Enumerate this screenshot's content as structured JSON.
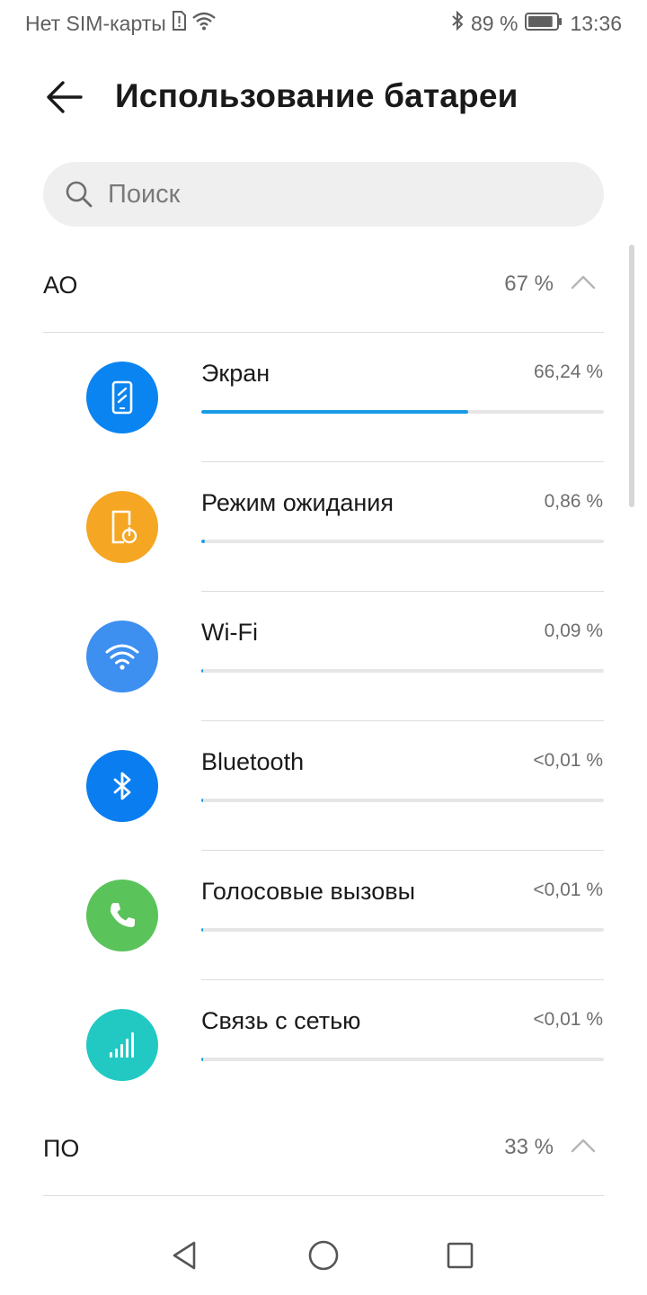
{
  "status_bar": {
    "carrier": "Нет SIM-карты",
    "battery_percent": "89 %",
    "time": "13:36",
    "icons": [
      "sim-alert-icon",
      "wifi-icon",
      "bluetooth-icon",
      "battery-icon"
    ],
    "battery_level": 0.89
  },
  "header": {
    "title": "Использование батареи",
    "back_icon": "back-arrow-icon"
  },
  "search": {
    "placeholder": "Поиск",
    "value": ""
  },
  "sections": [
    {
      "title": "АО",
      "percent": "67 %",
      "expanded": true,
      "items": [
        {
          "name": "Экран",
          "percent": "66,24 %",
          "usage": 0.6624,
          "icon": "phone-screen-icon",
          "color": "#0a84f0"
        },
        {
          "name": "Режим ожидания",
          "percent": "0,86 %",
          "usage": 0.0086,
          "icon": "phone-standby-icon",
          "color": "#f5a623"
        },
        {
          "name": "Wi-Fi",
          "percent": "0,09 %",
          "usage": 0.0009,
          "icon": "wifi-icon",
          "color": "#3d8ff0"
        },
        {
          "name": "Bluetooth",
          "percent": "<0,01 %",
          "usage": 0.0001,
          "icon": "bluetooth-icon",
          "color": "#0a7ef0"
        },
        {
          "name": "Голосовые вызовы",
          "percent": "<0,01 %",
          "usage": 0.0001,
          "icon": "phone-call-icon",
          "color": "#5ac35a"
        },
        {
          "name": "Связь с сетью",
          "percent": "<0,01 %",
          "usage": 0.0001,
          "icon": "signal-bars-icon",
          "color": "#22c9c2"
        }
      ]
    },
    {
      "title": "ПО",
      "percent": "33 %",
      "expanded": true
    }
  ],
  "colors": {
    "accent": "#1a9be6",
    "track": "#e6e6e6",
    "divider": "#dcdcdc"
  },
  "nav_bar": {
    "icons": [
      "nav-back-icon",
      "nav-home-icon",
      "nav-recents-icon"
    ]
  }
}
